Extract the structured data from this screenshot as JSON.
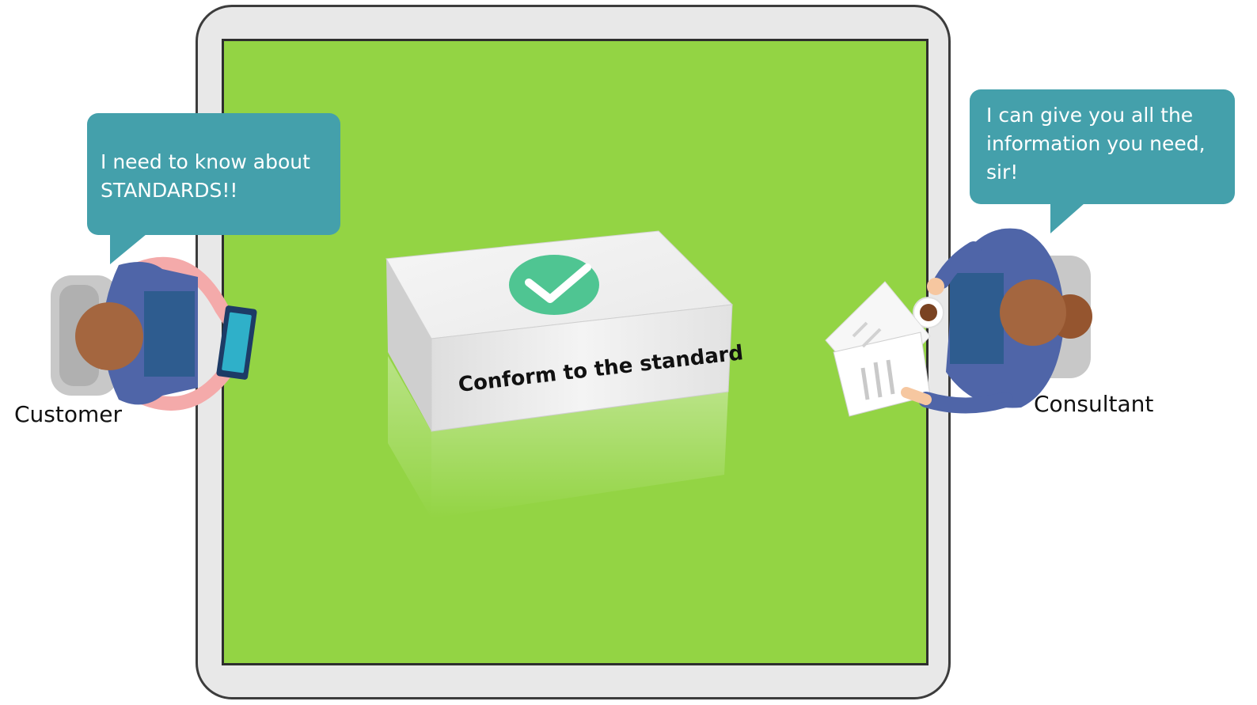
{
  "customer": {
    "speech": [
      "I need to know about",
      "STANDARDS!!"
    ],
    "label": "Customer",
    "icon": "tablet-icon"
  },
  "consultant": {
    "speech": [
      "I can give you all the",
      "information you need,",
      "sir!"
    ],
    "label": "Consultant",
    "icon": "documents-icon"
  },
  "product_box": {
    "label": "Conform to the standard",
    "icon": "checkmark-icon"
  },
  "colors": {
    "table_surface": "#93d444",
    "table_frame": "#e8e8e8",
    "speech_bubble": "#44a0ab",
    "checkmark_badge": "#4fc592",
    "shirt": "#4f65a8",
    "hair": "#a4663f"
  }
}
